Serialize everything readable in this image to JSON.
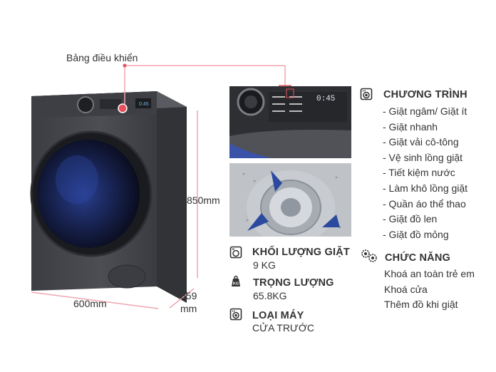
{
  "control_panel_label": "Bảng điều khiển",
  "dimensions": {
    "height": "850mm",
    "width": "600mm",
    "depth_top": "659",
    "depth_bottom": "mm"
  },
  "specs": [
    {
      "icon": "washer-weight-icon",
      "title": "KHỐI LƯỢNG GIẶT",
      "value": "9 KG"
    },
    {
      "icon": "kg-weight-icon",
      "title": "TRỌNG LƯỢNG",
      "value": "65.8KG"
    },
    {
      "icon": "washing-machine-icon",
      "title": "LOẠI MÁY",
      "value": "CỬA TRƯỚC"
    }
  ],
  "programs": {
    "icon": "washing-machine-icon",
    "title": "CHƯƠNG TRÌNH",
    "items": [
      "- Giặt ngâm/ Giặt ít",
      "- Giặt nhanh",
      "- Giặt vải cô-tông",
      "- Vệ sinh lồng giặt",
      "- Tiết kiệm nước",
      "- Làm khô lồng giặt",
      "- Quần áo thể thao",
      "- Giặt đồ len",
      "- Giặt đồ mỏng"
    ]
  },
  "features": {
    "icon": "gears-icon",
    "title": "CHỨC NĂNG",
    "items": [
      "Khoá an toàn trẻ em",
      "Khoá cửa",
      "Thêm đồ khi giặt"
    ]
  },
  "colors": {
    "accent_red": "#e8505b",
    "dimension_line": "#f0a6ae",
    "machine_body": "#48494e"
  }
}
